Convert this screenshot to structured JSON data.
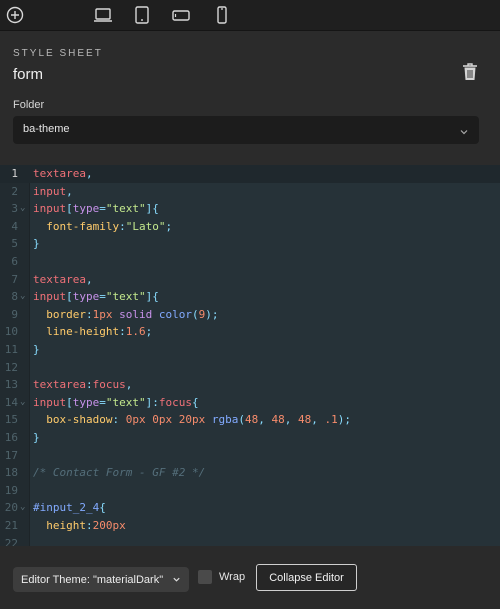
{
  "toolbar": {
    "icons": [
      "add-circle-icon",
      "laptop-icon",
      "tablet-icon",
      "phone-landscape-icon",
      "phone-portrait-icon"
    ]
  },
  "stylesheet": {
    "section_label": "STYLE SHEET",
    "name": "form",
    "delete_icon": "trash-icon"
  },
  "folder": {
    "label": "Folder",
    "selected": "ba-theme"
  },
  "editor": {
    "active_line": 1,
    "lines": [
      {
        "n": "1",
        "fold": "",
        "tokens": [
          [
            "sel",
            "textarea"
          ],
          [
            "punc",
            ","
          ]
        ]
      },
      {
        "n": "2",
        "fold": "",
        "tokens": [
          [
            "sel",
            "input"
          ],
          [
            "punc",
            ","
          ]
        ]
      },
      {
        "n": "3",
        "fold": "⌄",
        "tokens": [
          [
            "sel",
            "input"
          ],
          [
            "punc",
            "["
          ],
          [
            "attr",
            "type"
          ],
          [
            "punc",
            "="
          ],
          [
            "str",
            "\"text\""
          ],
          [
            "punc",
            "]{"
          ]
        ]
      },
      {
        "n": "4",
        "fold": "",
        "tokens": [
          [
            "plain",
            "  "
          ],
          [
            "prop",
            "font-family"
          ],
          [
            "punc",
            ":"
          ],
          [
            "str",
            "\"Lato\""
          ],
          [
            "punc",
            ";"
          ]
        ]
      },
      {
        "n": "5",
        "fold": "",
        "tokens": [
          [
            "punc",
            "}"
          ]
        ]
      },
      {
        "n": "6",
        "fold": "",
        "tokens": []
      },
      {
        "n": "7",
        "fold": "",
        "tokens": [
          [
            "sel",
            "textarea"
          ],
          [
            "punc",
            ","
          ]
        ]
      },
      {
        "n": "8",
        "fold": "⌄",
        "tokens": [
          [
            "sel",
            "input"
          ],
          [
            "punc",
            "["
          ],
          [
            "attr",
            "type"
          ],
          [
            "punc",
            "="
          ],
          [
            "str",
            "\"text\""
          ],
          [
            "punc",
            "]{"
          ]
        ]
      },
      {
        "n": "9",
        "fold": "",
        "tokens": [
          [
            "plain",
            "  "
          ],
          [
            "prop",
            "border"
          ],
          [
            "punc",
            ":"
          ],
          [
            "num",
            "1px"
          ],
          [
            "plain",
            " "
          ],
          [
            "kw",
            "solid"
          ],
          [
            "plain",
            " "
          ],
          [
            "fn",
            "color"
          ],
          [
            "punc",
            "("
          ],
          [
            "num",
            "9"
          ],
          [
            "punc",
            ");"
          ]
        ]
      },
      {
        "n": "10",
        "fold": "",
        "tokens": [
          [
            "plain",
            "  "
          ],
          [
            "prop",
            "line-height"
          ],
          [
            "punc",
            ":"
          ],
          [
            "num",
            "1.6"
          ],
          [
            "punc",
            ";"
          ]
        ]
      },
      {
        "n": "11",
        "fold": "",
        "tokens": [
          [
            "punc",
            "}"
          ]
        ]
      },
      {
        "n": "12",
        "fold": "",
        "tokens": []
      },
      {
        "n": "13",
        "fold": "",
        "tokens": [
          [
            "sel",
            "textarea"
          ],
          [
            "punc",
            ":"
          ],
          [
            "sel",
            "focus"
          ],
          [
            "punc",
            ","
          ]
        ]
      },
      {
        "n": "14",
        "fold": "⌄",
        "tokens": [
          [
            "sel",
            "input"
          ],
          [
            "punc",
            "["
          ],
          [
            "attr",
            "type"
          ],
          [
            "punc",
            "="
          ],
          [
            "str",
            "\"text\""
          ],
          [
            "punc",
            "]:"
          ],
          [
            "sel",
            "focus"
          ],
          [
            "punc",
            "{"
          ]
        ]
      },
      {
        "n": "15",
        "fold": "",
        "tokens": [
          [
            "plain",
            "  "
          ],
          [
            "prop",
            "box-shadow"
          ],
          [
            "punc",
            ": "
          ],
          [
            "num",
            "0px"
          ],
          [
            "plain",
            " "
          ],
          [
            "num",
            "0px"
          ],
          [
            "plain",
            " "
          ],
          [
            "num",
            "20px"
          ],
          [
            "plain",
            " "
          ],
          [
            "fn",
            "rgba"
          ],
          [
            "punc",
            "("
          ],
          [
            "num",
            "48"
          ],
          [
            "punc",
            ", "
          ],
          [
            "num",
            "48"
          ],
          [
            "punc",
            ", "
          ],
          [
            "num",
            "48"
          ],
          [
            "punc",
            ", "
          ],
          [
            "num",
            ".1"
          ],
          [
            "punc",
            ");"
          ]
        ]
      },
      {
        "n": "16",
        "fold": "",
        "tokens": [
          [
            "punc",
            "}"
          ]
        ]
      },
      {
        "n": "17",
        "fold": "",
        "tokens": []
      },
      {
        "n": "18",
        "fold": "",
        "tokens": [
          [
            "comment",
            "/* Contact Form - GF #2 */"
          ]
        ]
      },
      {
        "n": "19",
        "fold": "",
        "tokens": []
      },
      {
        "n": "20",
        "fold": "⌄",
        "tokens": [
          [
            "id",
            "#input_2_4"
          ],
          [
            "punc",
            "{"
          ]
        ]
      },
      {
        "n": "21",
        "fold": "",
        "tokens": [
          [
            "plain",
            "  "
          ],
          [
            "prop",
            "height"
          ],
          [
            "punc",
            ":"
          ],
          [
            "num",
            "200px"
          ]
        ]
      },
      {
        "n": "22",
        "fold": "",
        "tokens": []
      }
    ]
  },
  "footer": {
    "theme_button": "Editor Theme: \"materialDark\"",
    "wrap_label": "Wrap",
    "wrap_checked": false,
    "collapse_button": "Collapse Editor"
  }
}
